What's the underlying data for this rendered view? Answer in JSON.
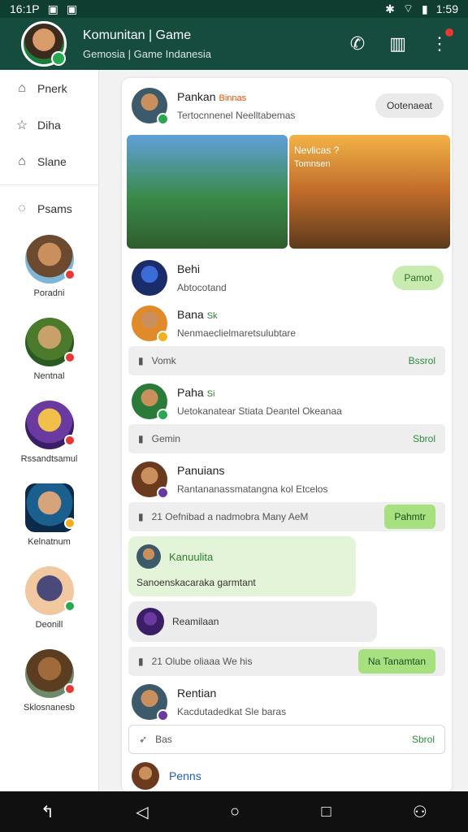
{
  "status": {
    "time": "16:1P",
    "right_time": "1:59"
  },
  "header": {
    "title": "Komunitan | Game",
    "subtitle": "Gemosia | Game Indanesia"
  },
  "sidebar": {
    "nav": [
      "Pnerk",
      "Diha",
      "Slane",
      "Psams"
    ],
    "avatars": [
      {
        "label": "Poradni"
      },
      {
        "label": "Nentnal"
      },
      {
        "label": "Rssandtsamul"
      },
      {
        "label": "Kelnatnum"
      },
      {
        "label": "Deonill"
      },
      {
        "label": "Sklosnanesb"
      }
    ]
  },
  "feed": {
    "post": {
      "author": "Pankan",
      "tag": "Binnas",
      "subtitle": "Tertocnnenel Neelltabemas",
      "button": "Ootenaeat"
    },
    "images": [
      {
        "caption": ""
      },
      {
        "caption": "Nevlicas ?",
        "caption2": "Tomnsen"
      }
    ],
    "rows": [
      {
        "name": "Behi",
        "sub": "Abtocotand",
        "btn": "Pamot"
      },
      {
        "name": "Bana",
        "tag": "Sk",
        "sub": "Nenmaeclielmaretsulubtare"
      },
      {
        "name": "Paha",
        "tag": "Si",
        "sub": "Uetokanatear Stiata Deantel Okeanaa"
      },
      {
        "name": "Panuians",
        "sub": "Rantananassmatangna kol Etcelos"
      }
    ],
    "bars": [
      {
        "text": "Vomk",
        "right": "Bssrol"
      },
      {
        "text": "Gemin",
        "right": "Sbrol"
      },
      {
        "text": "21 Oefnibad a nadmobra Many AeM",
        "btn": "Pahmtr"
      }
    ],
    "bubble": {
      "name": "Kanuulita",
      "text": "Sanoenskacaraka garmtant"
    },
    "grey_bubble": {
      "text": "Reamilaan"
    },
    "bar4": {
      "text": "21 Olube oliaaa We his",
      "btn": "Na Tanamtan"
    },
    "row5": {
      "name": "Rentian",
      "sub": "Kacdutadedkat Sle baras"
    },
    "bar5": {
      "text": "Bas",
      "right": "Sbrol"
    },
    "row6": {
      "name": "Penns"
    }
  }
}
